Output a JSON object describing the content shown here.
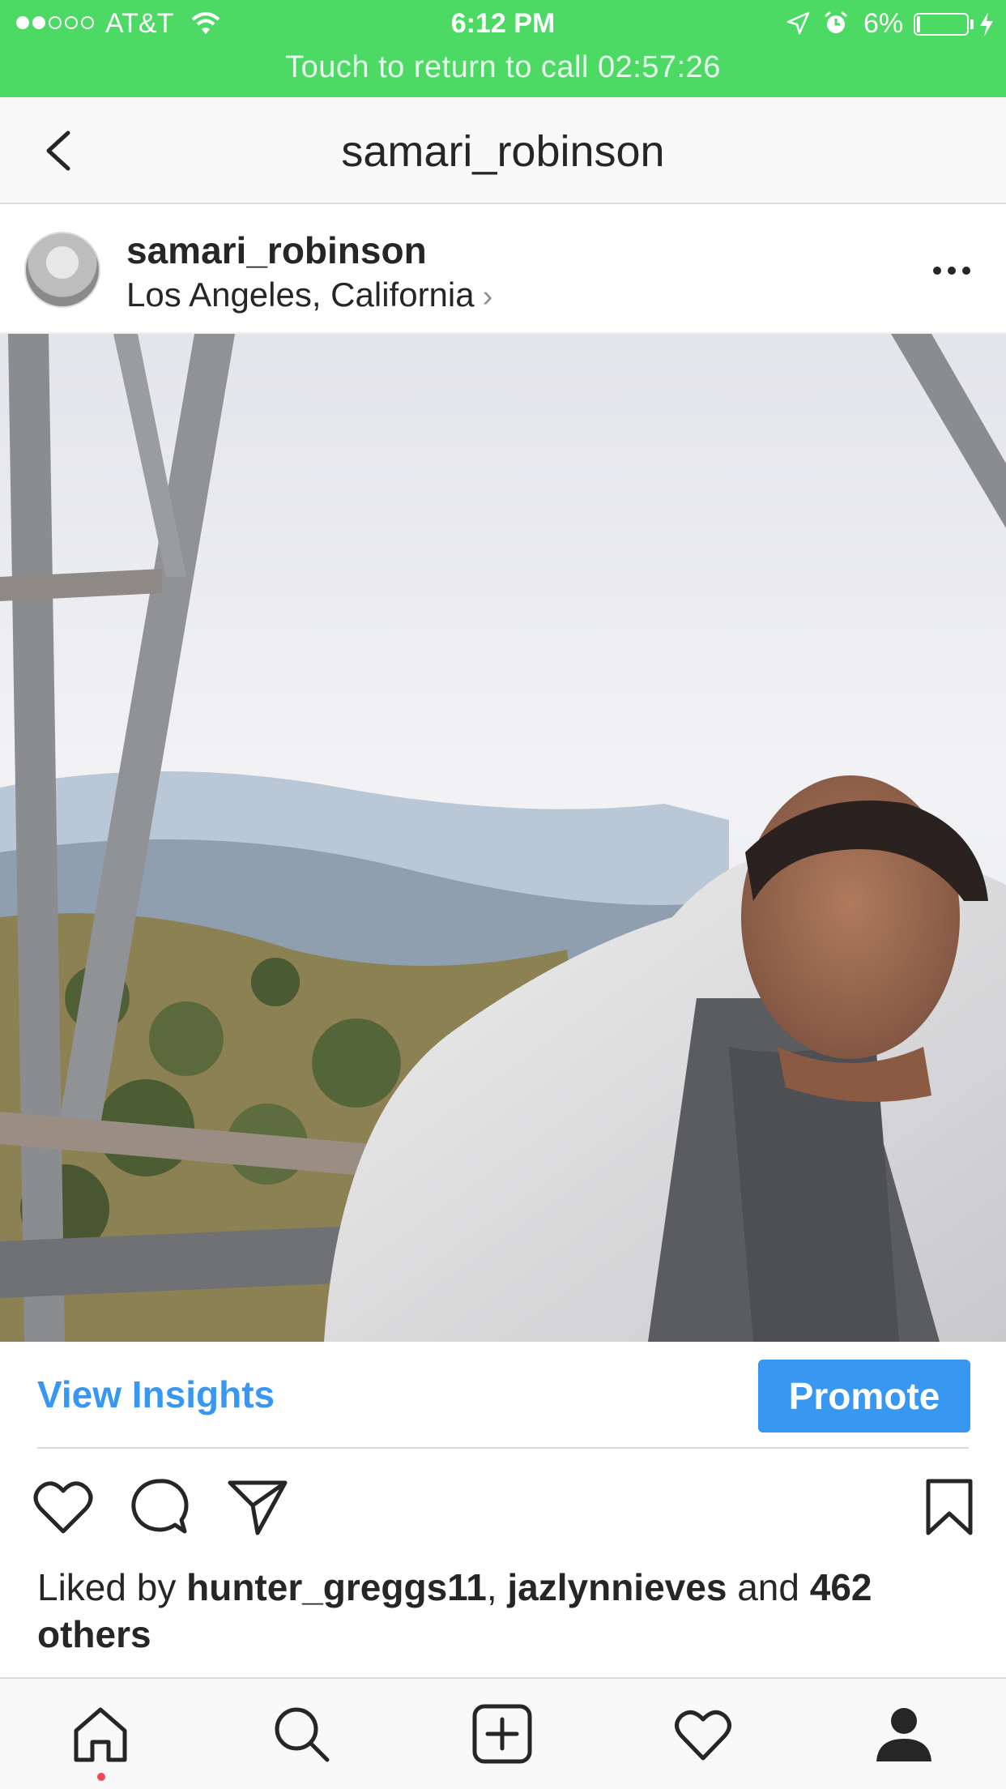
{
  "status_bar": {
    "carrier": "AT&T",
    "time": "6:12 PM",
    "battery_percent": "6%",
    "battery_level": 0.06,
    "signal_strength": 2,
    "call_text": "Touch to return to call 02:57:26",
    "color": "#4cd964"
  },
  "nav": {
    "title": "samari_robinson",
    "back_icon": "chevron-left-icon"
  },
  "post": {
    "username": "samari_robinson",
    "location": "Los Angeles, California",
    "more_icon": "ellipsis-icon"
  },
  "insights": {
    "view_insights_label": "View Insights",
    "promote_label": "Promote",
    "accent": "#3897f0"
  },
  "actions": {
    "icons": [
      "heart-icon",
      "comment-icon",
      "share-icon",
      "bookmark-icon"
    ]
  },
  "likes": {
    "prefix": "Liked by ",
    "user1": "hunter_greggs11",
    "sep": ", ",
    "user2": "jazlynnieves",
    "and": " and ",
    "others": "462 others"
  },
  "tabbar": {
    "tabs": [
      "home-icon",
      "search-icon",
      "add-icon",
      "activity-icon",
      "profile-icon"
    ],
    "notification_color": "#ed4956"
  }
}
